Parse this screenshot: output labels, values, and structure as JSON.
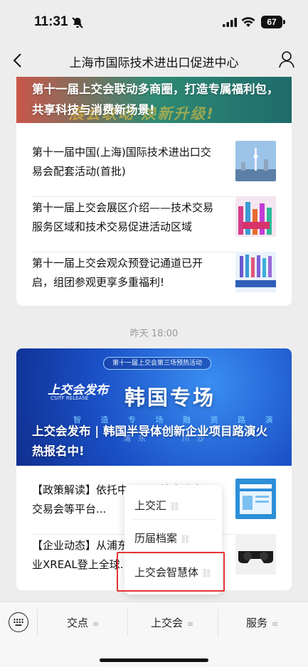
{
  "status_bar": {
    "time": "11:31",
    "battery": "67"
  },
  "nav": {
    "title": "上海市国际技术进出口促进中心"
  },
  "card1": {
    "banner_text": "第十一届上交会联动多商圈，打造专属福利包，共享科技与消费新场景!",
    "banner_ghost": "展会联动  焕新升级!",
    "items": [
      {
        "text": "第十一届中国(上海)国际技术进出口交易会配套活动(首批)"
      },
      {
        "text": "第十一届上交会展区介绍——技术交易服务区域和技术交易促进活动区域"
      },
      {
        "text": "第十一届上交会观众预登记通道已开启，组团参观更享多重福利!"
      }
    ]
  },
  "date_label": "昨天 18:00",
  "card2": {
    "pill": "第十一届上交会第三场预热活动",
    "logo": "上交会发布",
    "logo_sub": "CSITF RELEASE",
    "big": "韩国专场",
    "sub": "智 造 专 场 融 资 路 演",
    "city": "浦东 · 川沙",
    "banner_text": "上交会发布 | 韩国半导体创新企业项目路演火热报名中!",
    "items": [
      {
        "text": "【政策解读】依托中国国际技术进出口交易会等平台..."
      },
      {
        "text": "【企业动态】从浦东走向全球，张江企业XREAL登上全球..."
      }
    ]
  },
  "popup_menu": {
    "items": [
      {
        "label": "上交汇"
      },
      {
        "label": "历届档案"
      },
      {
        "label": "上交会智慧体"
      }
    ]
  },
  "tabbar": {
    "tabs": [
      {
        "label": "交点"
      },
      {
        "label": "上交会"
      },
      {
        "label": "服务"
      }
    ]
  },
  "colors": {
    "highlight": "#e53333",
    "banner_blue": "#1a4fc5"
  }
}
